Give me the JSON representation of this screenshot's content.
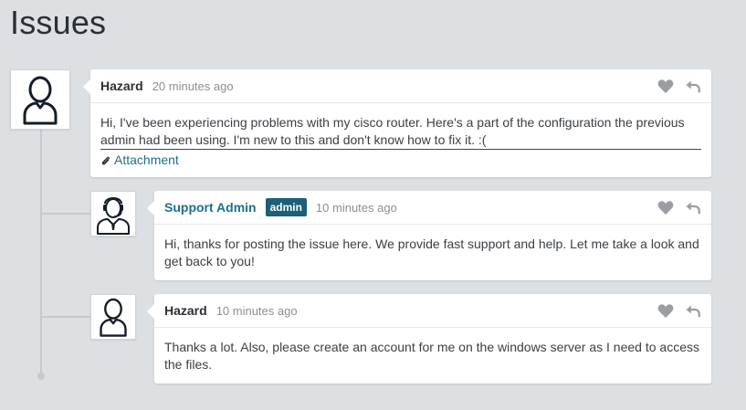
{
  "page": {
    "title": "Issues"
  },
  "comments": [
    {
      "author": "Hazard",
      "time": "20 minutes ago",
      "body": "Hi, I've been experiencing problems with my cisco router. Here's a part of the configuration the previous admin had been using. I'm new to this and don't know how to fix it. :(",
      "attachment_label": "Attachment"
    },
    {
      "author": "Support Admin",
      "badge": "admin",
      "time": "10 minutes ago",
      "body": "Hi, thanks for posting the issue here. We provide fast support and help. Let me take a look and get back to you!"
    },
    {
      "author": "Hazard",
      "time": "10 minutes ago",
      "body": "Thanks a lot. Also, please create an account for me on the windows server as I need to access the files."
    }
  ],
  "icons": {
    "like": "heart-icon",
    "reply": "reply-icon",
    "attachment": "paperclip-icon",
    "user_avatar": "user-outline-icon",
    "support_avatar": "support-agent-headset-icon"
  },
  "colors": {
    "background": "#dde0e3",
    "link": "#1f6f8b",
    "badge": "#1b5f7a",
    "icon_gray": "#9a9ea2"
  }
}
